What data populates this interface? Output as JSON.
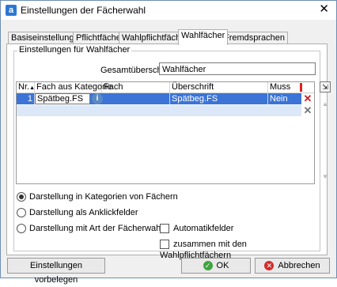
{
  "window": {
    "title": "Einstellungen der Fächerwahl",
    "app_letter": "a",
    "close_glyph": "✕"
  },
  "tabs": [
    "Basiseinstellungen",
    "Pflichtfächer",
    "Wahlpflichtfächer",
    "Wahlfächer",
    "Fremdsprachen"
  ],
  "active_tab": "Wahlfächer",
  "group": {
    "title": "Einstellungen für Wahlfächer",
    "gesamt_label": "Gesamtüberschrift",
    "gesamt_value": "Wahlfächer"
  },
  "grid": {
    "headers": {
      "nr": "Nr.",
      "kategorie": "Fach aus Kategorie",
      "fach": "Fach",
      "ueberschrift": "Überschrift",
      "muss": "Muss"
    },
    "rows": [
      {
        "nr": "1",
        "kategorie": "Spätbeg.FS",
        "fach": "",
        "ueberschrift": "Spätbeg.FS",
        "muss": "Nein"
      }
    ],
    "sort_glyph": "▲",
    "info_glyph": "i",
    "delete_glyph": "✕",
    "add_row_glyph": "⇲",
    "scroll_up_glyph": "▲",
    "scroll_down_glyph": "▼"
  },
  "options": {
    "radio_kategorien": "Darstellung in Kategorien von Fächern",
    "radio_anklick": "Darstellung als Anklickfelder",
    "radio_art": "Darstellung mit Art der Fächerwahl",
    "cb_automatik": "Automatikfelder",
    "cb_zusammen": "zusammen mit den Wahlpflichtfächern",
    "selected_radio": "radio_kategorien"
  },
  "buttons": {
    "vorbelegen": "Einstellungen vorbelegen",
    "ok": "OK",
    "abbrechen": "Abbrechen",
    "ok_glyph": "✓",
    "cancel_glyph": "✕"
  },
  "colors": {
    "selection": "#3b74d6",
    "accent": "#2b78d4"
  }
}
